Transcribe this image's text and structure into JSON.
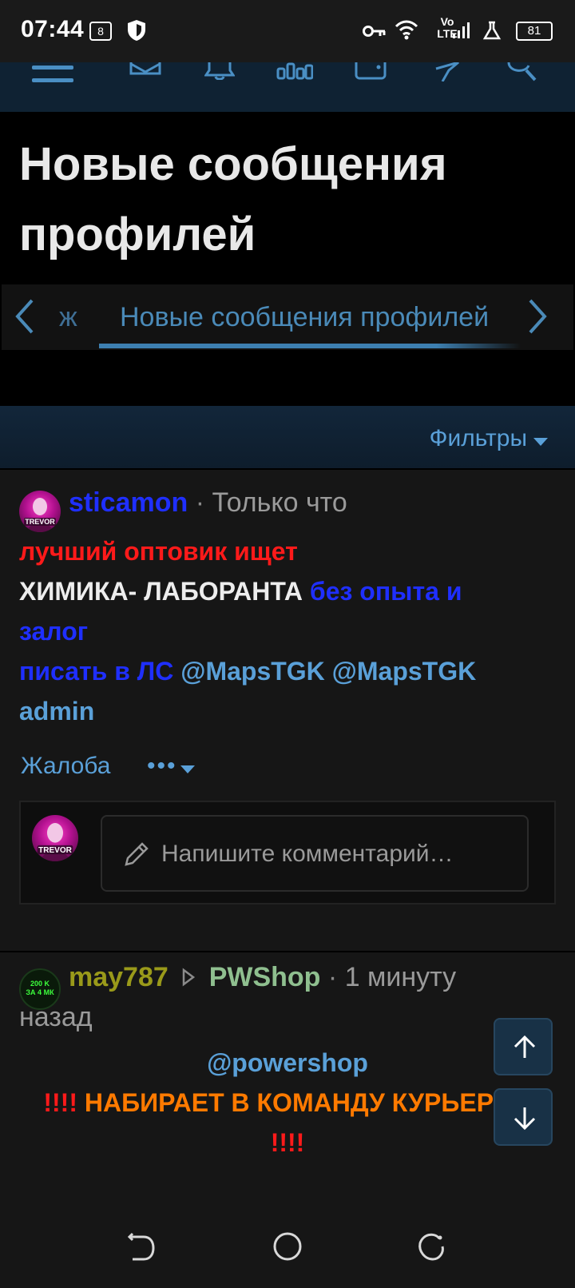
{
  "status_bar": {
    "time": "07:44",
    "network_type": "Vo LTE",
    "battery": "81"
  },
  "app_header": {
    "icons": [
      "menu-icon",
      "mail-icon",
      "bell-icon",
      "stats-icon",
      "wallet-icon",
      "lightning-icon",
      "search-icon"
    ]
  },
  "page": {
    "title_line1": "Новые сообщения",
    "title_line2": "профилей"
  },
  "tabs": {
    "prev_fragment": "ж",
    "active_label": "Новые сообщения профилей"
  },
  "filters": {
    "label": "Фильтры"
  },
  "posts": [
    {
      "author": "sticamon",
      "separator": "·",
      "time": "Только что",
      "body": {
        "line1": "лучший оптовик ищет",
        "line2_white": "ХИМИКА- ЛАБОРАНТА ",
        "line2_blue": "без опыта и",
        "line3": "залог",
        "line4_blue": "писать в ЛС ",
        "line4_mention": "@MapsTGK @MapsTGK",
        "line5_mention": "admin"
      },
      "complaint_label": "Жалоба",
      "more_label": "•••",
      "comment_placeholder": "Напишите комментарий…"
    },
    {
      "author": "may787",
      "target": "PWShop",
      "separator": "·",
      "time_line1": "1 минуту",
      "time_line2": "назад",
      "avatar_text_line1": "200 K",
      "avatar_text_line2": "ЗА 4 МК",
      "body": {
        "mention": "@powershop",
        "line2_red_prefix": "!!!! ",
        "line2_orange": "НАБИРАЕТ В КОМАНДУ КУРЬЕРОВ",
        "line3_red": "!!!!"
      }
    }
  ],
  "colors": {
    "accent": "#5aa0d8",
    "header_bg": "#0f2233",
    "red_text": "#ff1a1a",
    "blue_text": "#1f2fff",
    "orange_text": "#ff7a00",
    "author2_color": "#9a9a1a",
    "target_color": "#8fbf8f"
  }
}
